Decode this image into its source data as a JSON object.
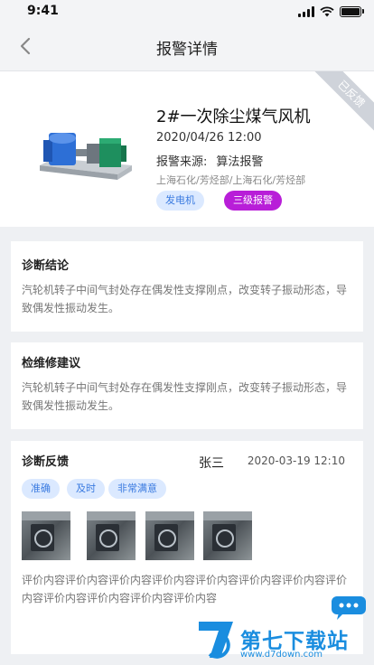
{
  "status": {
    "time": "9:41"
  },
  "nav": {
    "title": "报警详情",
    "back_icon": "chevron-left-icon"
  },
  "alarm": {
    "ribbon": "已反馈",
    "title": "2#一次除尘煤气风机",
    "date": "2020/04/26 12:00",
    "source_label": "报警来源:",
    "source_value": "算法报警",
    "path": "上海石化/芳烃部/上海石化/芳烃部",
    "tag_device": "发电机",
    "tag_level": "三级报警",
    "colors": {
      "device_tag_bg": "#dbe9ff",
      "level_tag_bg": "#b81ed8"
    }
  },
  "diagnosis": {
    "title": "诊断结论",
    "text": "汽轮机转子中间气封处存在偶发性支撑刚点，改变转子振动形态，导致偶发性振动发生。"
  },
  "maintenance": {
    "title": "检维修建议",
    "text": "汽轮机转子中间气封处存在偶发性支撑刚点，改变转子振动形态，导致偶发性振动发生。"
  },
  "feedback": {
    "title": "诊断反馈",
    "user": "张三",
    "time": "2020-03-19 12:10",
    "tags": [
      "准确",
      "及时",
      "非常满意"
    ],
    "photo_count": 4,
    "comment": "评价内容评价内容评价内容评价内容评价内容评价内容评价内容评价内容评价内容评价内容评价内容评价内容"
  },
  "watermark": {
    "name": "第七下载站",
    "url": "www.d7down.com"
  }
}
